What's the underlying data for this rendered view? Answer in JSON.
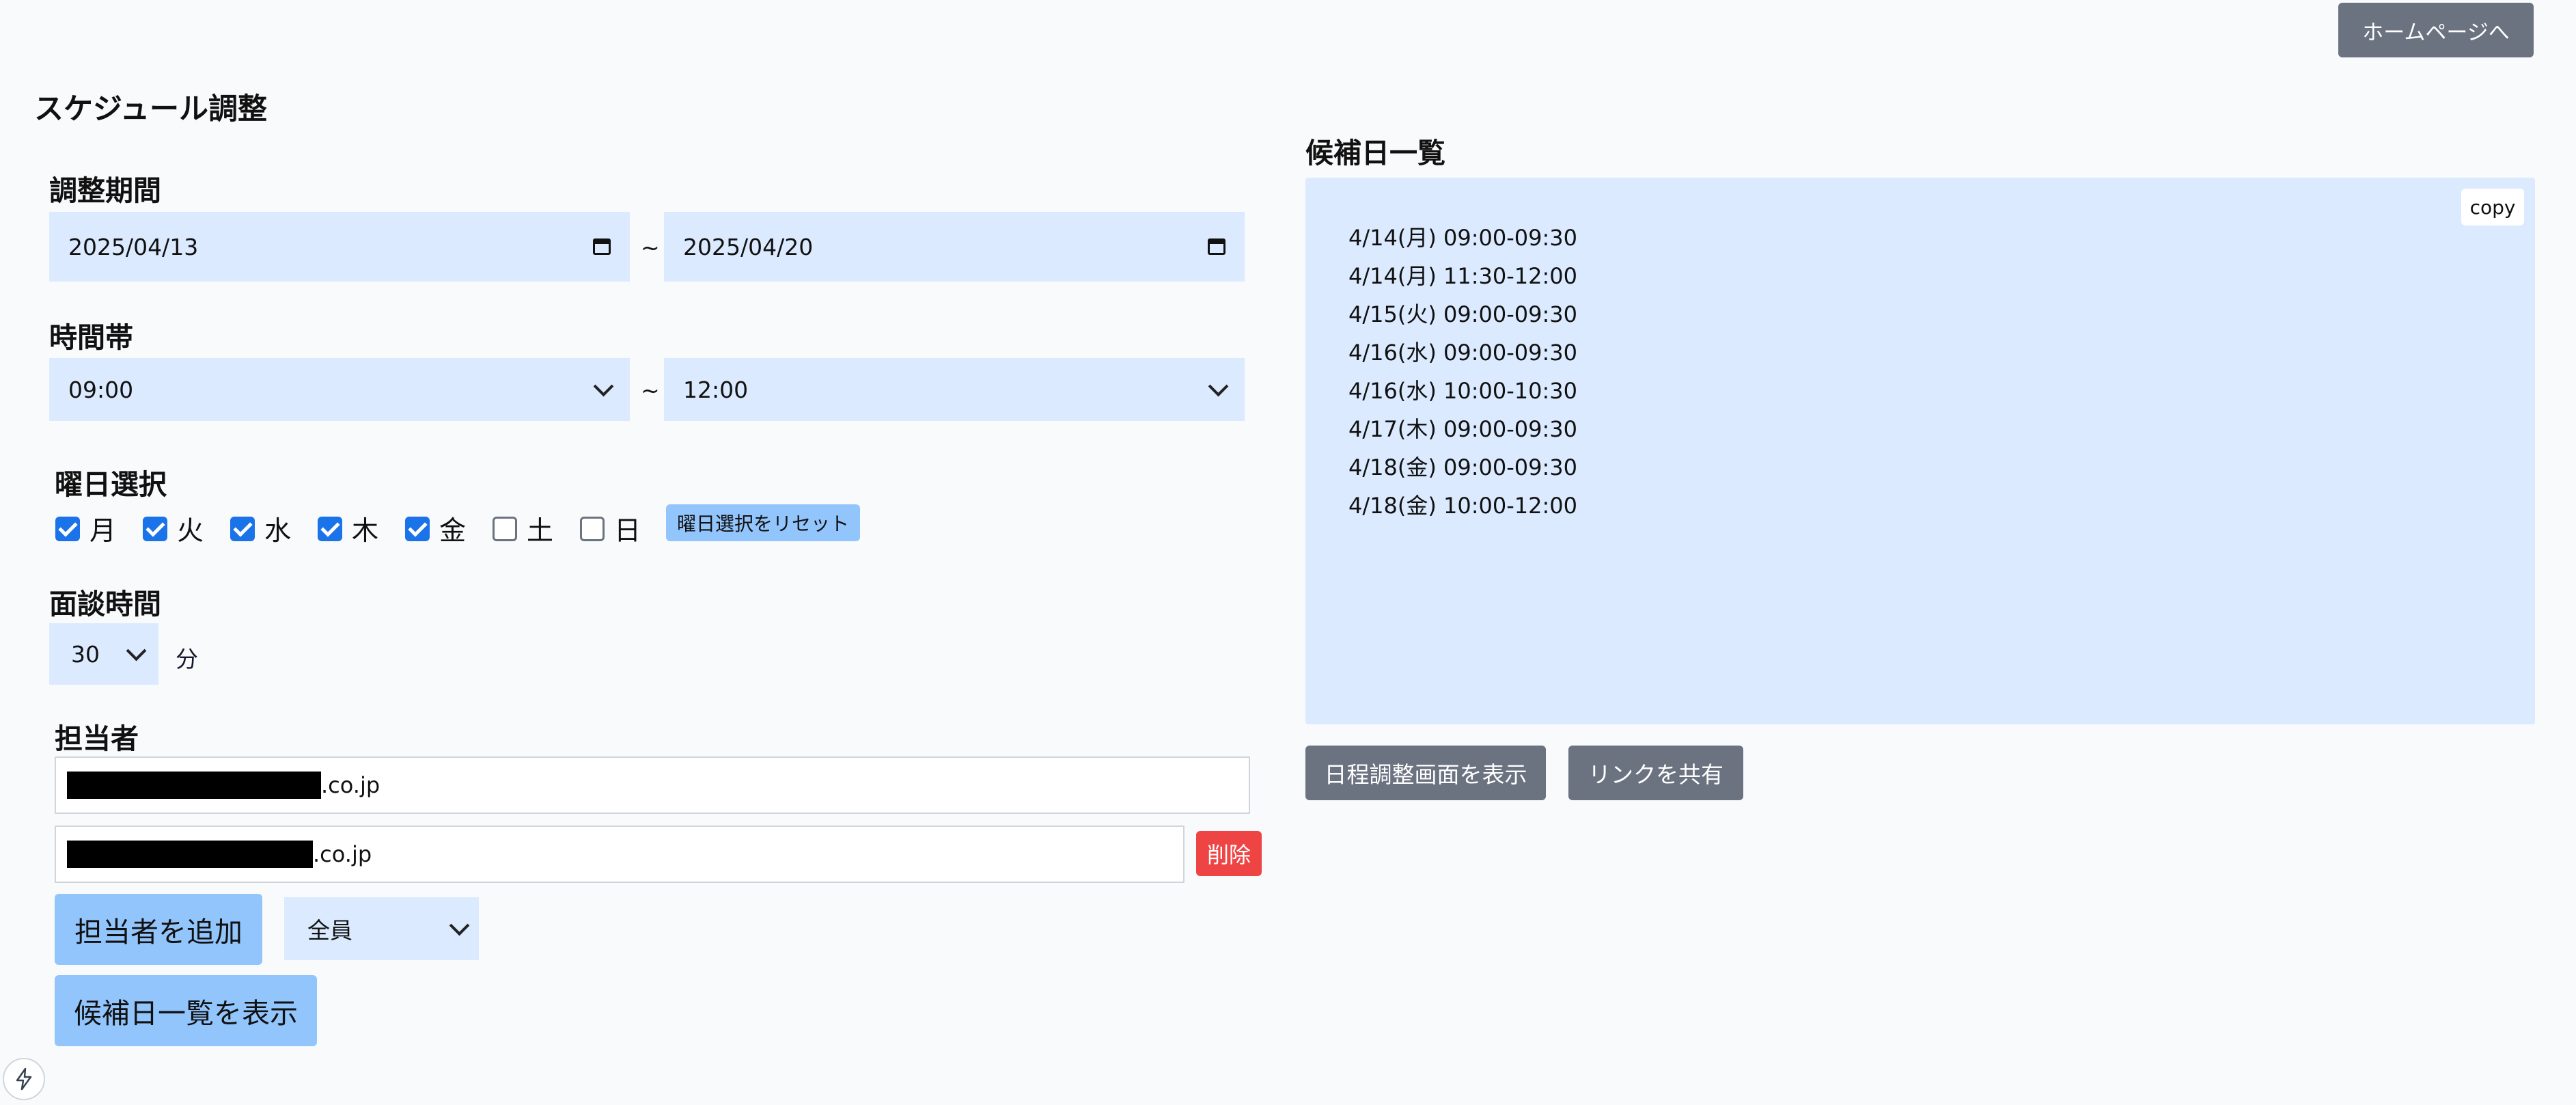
{
  "header": {
    "home_button": "ホームページへ"
  },
  "page_title": "スケジュール調整",
  "period": {
    "label": "調整期間",
    "start": "2025/04/13",
    "separator": "~",
    "end": "2025/04/20"
  },
  "time_range": {
    "label": "時間帯",
    "start": "09:00",
    "separator": "~",
    "end": "12:00"
  },
  "weekdays": {
    "label": "曜日選択",
    "days": [
      {
        "label": "月",
        "checked": true
      },
      {
        "label": "火",
        "checked": true
      },
      {
        "label": "水",
        "checked": true
      },
      {
        "label": "木",
        "checked": true
      },
      {
        "label": "金",
        "checked": true
      },
      {
        "label": "土",
        "checked": false
      },
      {
        "label": "日",
        "checked": false
      }
    ],
    "reset_button": "曜日選択をリセット"
  },
  "duration": {
    "label": "面談時間",
    "value": "30",
    "unit": "分"
  },
  "assignees": {
    "label": "担当者",
    "entries": [
      {
        "visible_suffix": ".co.jp"
      },
      {
        "visible_suffix": ".co.jp"
      }
    ],
    "delete_button": "削除",
    "add_button": "担当者を追加",
    "mode_select": "全員"
  },
  "show_candidates_button": "候補日一覧を表示",
  "candidates": {
    "label": "候補日一覧",
    "copy_button": "copy",
    "items": [
      "4/14(月) 09:00-09:30",
      "4/14(月) 11:30-12:00",
      "4/15(火) 09:00-09:30",
      "4/16(水) 09:00-09:30",
      "4/16(水) 10:00-10:30",
      "4/17(木) 09:00-09:30",
      "4/18(金) 09:00-09:30",
      "4/18(金) 10:00-12:00"
    ],
    "show_schedule_button": "日程調整画面を表示",
    "share_link_button": "リンクを共有"
  },
  "colors": {
    "field_bg": "#dbeafe",
    "primary_light": "#93c5fd",
    "gray_button": "#6b7280",
    "danger": "#ef4444",
    "checkbox": "#1a73e8"
  }
}
